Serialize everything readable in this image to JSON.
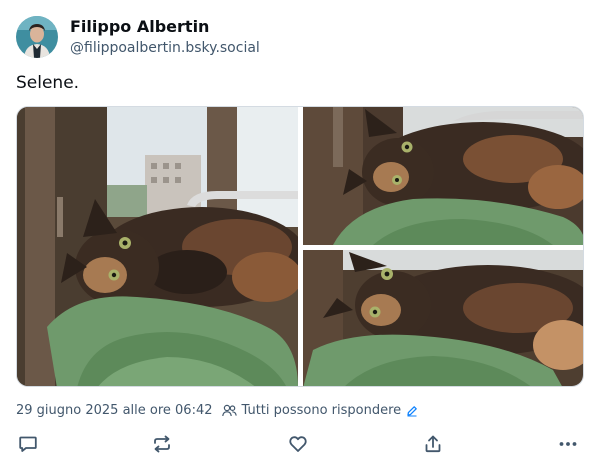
{
  "author": {
    "display_name": "Filippo Albertin",
    "handle": "@filippoalbertin.bsky.social",
    "avatar_icon": "avatar-photo"
  },
  "post": {
    "text": "Selene.",
    "images": [
      {
        "icon": "cat-photo-icon"
      },
      {
        "icon": "cat-photo-icon"
      },
      {
        "icon": "cat-photo-icon"
      }
    ]
  },
  "meta": {
    "timestamp": "29 giugno 2025 alle ore 06:42",
    "reply_setting": "Tutti possono rispondere",
    "reply_icon": "people-icon",
    "edit_icon": "pencil-icon"
  },
  "actions": [
    {
      "name": "reply",
      "icon": "comment-icon"
    },
    {
      "name": "repost",
      "icon": "repost-icon"
    },
    {
      "name": "like",
      "icon": "heart-icon"
    },
    {
      "name": "share",
      "icon": "share-icon"
    },
    {
      "name": "more",
      "icon": "more-icon"
    }
  ],
  "colors": {
    "text": "#0b0f14",
    "secondary": "#42576c",
    "accent": "#1083fe",
    "border": "#d4dbe2"
  }
}
